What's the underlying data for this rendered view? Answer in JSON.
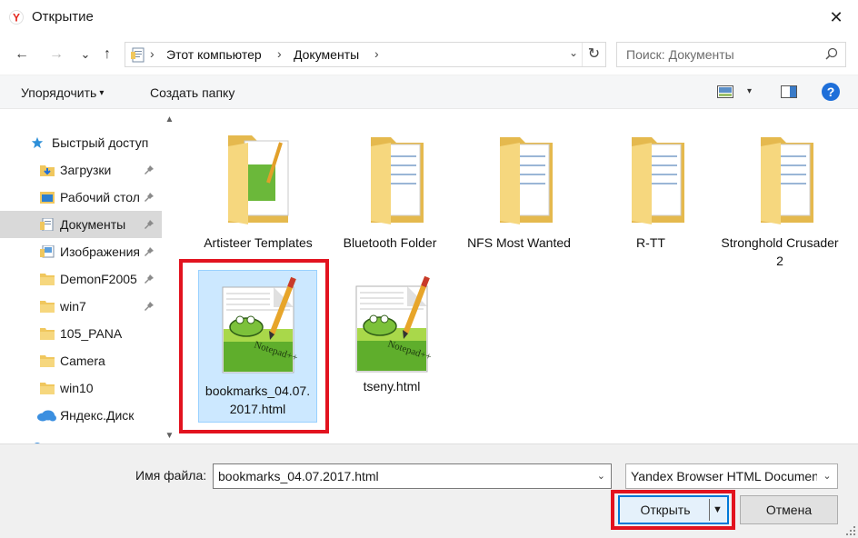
{
  "window": {
    "title": "Открытие",
    "close_glyph": "✕",
    "colors": {
      "accent": "#0078d7",
      "highlight": "#e2131f",
      "selection": "#cce8ff",
      "folder": "#f0c75e"
    }
  },
  "nav": {
    "back_glyph": "←",
    "forward_glyph": "→",
    "recent_glyph": "⌄",
    "up_glyph": "↑",
    "breadcrumbs": [
      "Этот компьютер",
      "Документы"
    ],
    "sep_glyph": "›",
    "dropdown_glyph": "⌄",
    "refresh_glyph": "↻",
    "search_placeholder": "Поиск: Документы"
  },
  "toolbar": {
    "organize_label": "Упорядочить",
    "organize_caret": "▾",
    "new_folder_label": "Создать папку",
    "view_caret": "▾",
    "help_label": "?"
  },
  "sidebar": {
    "quick_access": "Быстрый доступ",
    "items": [
      {
        "label": "Загрузки",
        "icon": "downloads-icon",
        "pinned": true
      },
      {
        "label": "Рабочий стол",
        "icon": "desktop-icon",
        "pinned": true
      },
      {
        "label": "Документы",
        "icon": "documents-icon",
        "pinned": true,
        "selected": true
      },
      {
        "label": "Изображения",
        "icon": "pictures-icon",
        "pinned": true
      },
      {
        "label": "DemonF2005",
        "icon": "folder-icon",
        "pinned": true
      },
      {
        "label": "win7",
        "icon": "folder-icon",
        "pinned": true
      },
      {
        "label": "105_PANA",
        "icon": "folder-icon",
        "pinned": false
      },
      {
        "label": "Camera",
        "icon": "folder-icon",
        "pinned": false
      },
      {
        "label": "win10",
        "icon": "folder-icon",
        "pinned": false
      }
    ],
    "yandex_disk": "Яндекс.Диск",
    "scroll_up_glyph": "▲",
    "scroll_down_glyph": "▼"
  },
  "files": [
    {
      "name": "Artisteer Templates",
      "type": "folder-doc"
    },
    {
      "name": "Bluetooth Folder",
      "type": "folder"
    },
    {
      "name": "NFS Most Wanted",
      "type": "folder"
    },
    {
      "name": "R-TT",
      "type": "folder"
    },
    {
      "name": "Stronghold Crusader 2",
      "type": "folder"
    },
    {
      "name": "bookmarks_04.07.2017.html",
      "name_display": "bookmarks_04.07. 2017.html",
      "type": "notepad",
      "selected": true
    },
    {
      "name": "tseny.html",
      "type": "notepad"
    }
  ],
  "footer": {
    "filename_label": "Имя файла:",
    "filename_value": "bookmarks_04.07.2017.html",
    "filename_dd": "⌄",
    "filter_value": "Yandex Browser HTML Document",
    "filter_dd": "⌄",
    "open_label": "Открыть",
    "open_split_glyph": "▼",
    "cancel_label": "Отмена"
  }
}
